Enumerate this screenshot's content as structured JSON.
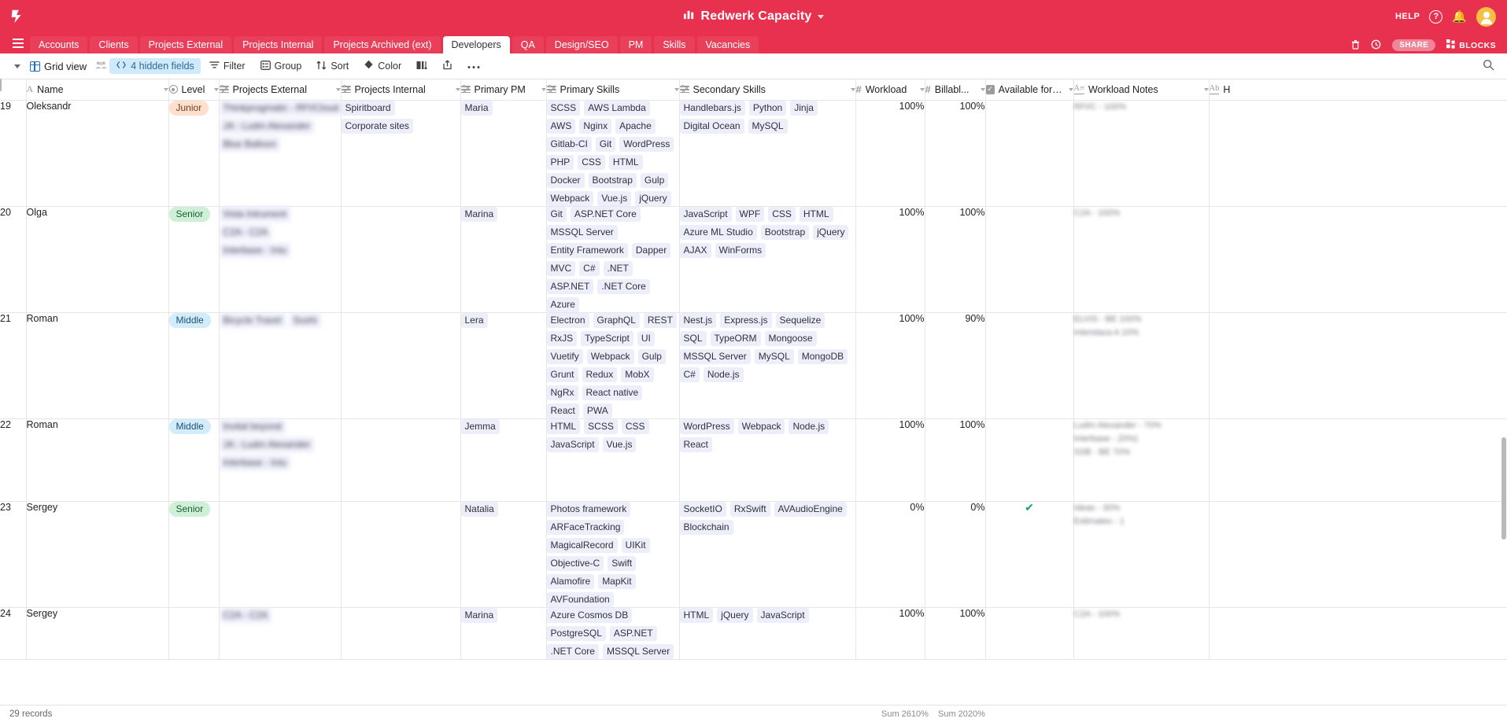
{
  "header": {
    "logo_icon": "redwerk-logo-icon",
    "app_title": "Redwerk Capacity",
    "title_icon": "bar-chart-icon",
    "title_caret_icon": "caret-down-icon",
    "help_label": "HELP",
    "help_icon": "question-circle-icon",
    "bell_icon": "bell-icon",
    "avatar_icon": "user-avatar",
    "brand_color": "#e8314f"
  },
  "tabs": {
    "menu_icon": "hamburger-menu-icon",
    "items": [
      {
        "label": "Accounts",
        "active": false
      },
      {
        "label": "Clients",
        "active": false
      },
      {
        "label": "Projects External",
        "active": false
      },
      {
        "label": "Projects Internal",
        "active": false
      },
      {
        "label": "Projects Archived (ext)",
        "active": false
      },
      {
        "label": "Developers",
        "active": true
      },
      {
        "label": "QA",
        "active": false
      },
      {
        "label": "Design/SEO",
        "active": false
      },
      {
        "label": "PM",
        "active": false
      },
      {
        "label": "Skills",
        "active": false
      },
      {
        "label": "Vacancies",
        "active": false
      }
    ],
    "right_actions": [
      {
        "label": "",
        "icon": "trash-icon"
      },
      {
        "label": "",
        "icon": "history-clock-icon"
      },
      {
        "label": "SHARE",
        "icon": "share-pill"
      },
      {
        "label": "BLOCKS",
        "icon": "blocks-icon"
      }
    ]
  },
  "toolbar": {
    "view_caret_icon": "caret-down-icon",
    "view_icon": "grid-view-icon",
    "view_name": "Grid view",
    "collaborators_icon": "collaborators-icon",
    "hidden_fields_label": "4 hidden fields",
    "hidden_fields_icon": "hidden-fields-icon",
    "filter_label": "Filter",
    "filter_icon": "filter-icon",
    "group_label": "Group",
    "group_icon": "group-icon",
    "sort_label": "Sort",
    "sort_icon": "sort-icon",
    "color_label": "Color",
    "color_icon": "color-palette-icon",
    "row_height_icon": "row-height-icon",
    "share_view_icon": "share-view-icon",
    "more_icon": "more-horizontal-icon",
    "search_icon": "search-icon"
  },
  "grid": {
    "columns": [
      {
        "label": "Name",
        "icon": "text-field-icon"
      },
      {
        "label": "Level",
        "icon": "single-select-icon"
      },
      {
        "label": "Projects External",
        "icon": "multi-select-icon"
      },
      {
        "label": "Projects Internal",
        "icon": "multi-select-icon"
      },
      {
        "label": "Primary PM",
        "icon": "multi-select-icon"
      },
      {
        "label": "Primary Skills",
        "icon": "multi-select-icon"
      },
      {
        "label": "Secondary Skills",
        "icon": "multi-select-icon"
      },
      {
        "label": "Workload",
        "icon": "number-field-icon"
      },
      {
        "label": "Billabl...",
        "icon": "number-field-icon"
      },
      {
        "label": "Available for E...",
        "icon": "checkbox-field-icon"
      },
      {
        "label": "Workload Notes",
        "icon": "long-text-icon"
      },
      {
        "label": "H",
        "icon": "text-field-icon"
      }
    ],
    "rows": [
      {
        "num": "19",
        "name": "Oleksandr",
        "level": "Junior",
        "level_class": "junior",
        "projects_external_redacted": [
          "Thinkprogmatic - RFI/Cloud",
          "JA - Ludm Alexander",
          "Blue Balloon"
        ],
        "projects_internal": [
          "Spiritboard",
          "Corporate sites"
        ],
        "primary_pm": [
          "Maria"
        ],
        "primary_skills": [
          "SCSS",
          "AWS Lambda",
          "AWS",
          "Nginx",
          "Apache",
          "Gitlab-CI",
          "Git",
          "WordPress",
          "PHP",
          "CSS",
          "HTML",
          "Docker",
          "Bootstrap",
          "Gulp",
          "Webpack",
          "Vue.js",
          "jQuery"
        ],
        "secondary_skills": [
          "Handlebars.js",
          "Python",
          "Jinja",
          "Digital Ocean",
          "MySQL"
        ],
        "workload": "100%",
        "billable": "100%",
        "available": false,
        "notes_redacted": [
          "RFI/C - 100%"
        ]
      },
      {
        "num": "20",
        "name": "Olga",
        "level": "Senior",
        "level_class": "senior",
        "projects_external_redacted": [
          "Vista Intrument",
          "C2A - C2A",
          "Interbase - Intu"
        ],
        "projects_internal": [],
        "primary_pm": [
          "Marina"
        ],
        "primary_skills": [
          "Git",
          "ASP.NET Core",
          "MSSQL Server",
          "Entity Framework",
          "Dapper",
          "MVC",
          "C#",
          ".NET",
          "ASP.NET",
          ".NET Core",
          "Azure"
        ],
        "secondary_skills": [
          "JavaScript",
          "WPF",
          "CSS",
          "HTML",
          "Azure ML Studio",
          "Bootstrap",
          "jQuery",
          "AJAX",
          "WinForms"
        ],
        "workload": "100%",
        "billable": "100%",
        "available": false,
        "notes_redacted": [
          "C2A - 100%"
        ]
      },
      {
        "num": "21",
        "name": "Roman",
        "level": "Middle",
        "level_class": "middle",
        "projects_external_redacted": [
          "Bicycle Travel",
          "Sushi"
        ],
        "projects_internal": [],
        "primary_pm": [
          "Lera"
        ],
        "primary_skills": [
          "Electron",
          "GraphQL",
          "REST",
          "RxJS",
          "TypeScript",
          "UI",
          "Vuetify",
          "Webpack",
          "Gulp",
          "Grunt",
          "Redux",
          "MobX",
          "NgRx",
          "React native",
          "React",
          "PWA"
        ],
        "secondary_skills": [
          "Nest.js",
          "Express.js",
          "Sequelize",
          "SQL",
          "TypeORM",
          "Mongoose",
          "MSSQL Server",
          "MySQL",
          "MongoDB",
          "C#",
          "Node.js"
        ],
        "workload": "100%",
        "billable": "90%",
        "available": false,
        "notes_redacted": [
          "ELVIS - BE 100%",
          "Interstaca A 10%"
        ]
      },
      {
        "num": "22",
        "name": "Roman",
        "level": "Middle",
        "level_class": "middle",
        "projects_external_redacted": [
          "Invital beyond",
          "JA - Ludm Alexander",
          "Interbase - Intu"
        ],
        "projects_internal": [],
        "primary_pm": [
          "Jemma"
        ],
        "primary_skills": [
          "HTML",
          "SCSS",
          "CSS",
          "JavaScript",
          "Vue.js"
        ],
        "secondary_skills": [
          "WordPress",
          "Webpack",
          "Node.js",
          "React"
        ],
        "workload": "100%",
        "billable": "100%",
        "available": false,
        "notes_redacted": [
          "Ludm Alexander - 70%",
          "Interbase - 20%)",
          "SSB - BE 70%"
        ]
      },
      {
        "num": "23",
        "name": "Sergey",
        "level": "Senior",
        "level_class": "senior",
        "projects_external_redacted": [],
        "projects_internal": [],
        "primary_pm": [
          "Natalia"
        ],
        "primary_skills": [
          "Photos framework",
          "ARFaceTracking",
          "MagicalRecord",
          "UIKit",
          "Objective-C",
          "Swift",
          "Alamofire",
          "MapKit",
          "AVFoundation"
        ],
        "secondary_skills": [
          "SocketIO",
          "RxSwift",
          "AVAudioEngine",
          "Blockchain"
        ],
        "workload": "0%",
        "billable": "0%",
        "available": true,
        "notes_redacted": [
          "Ideas - 30%",
          "Estimates - 1"
        ]
      },
      {
        "num": "24",
        "name": "Sergey",
        "level": "",
        "level_class": "",
        "projects_external_redacted": [
          "C2A - C2A"
        ],
        "projects_internal": [],
        "primary_pm": [
          "Marina"
        ],
        "primary_skills": [
          "Azure Cosmos DB",
          "PostgreSQL",
          "ASP.NET",
          ".NET Core",
          "MSSQL Server"
        ],
        "secondary_skills": [
          "HTML",
          "jQuery",
          "JavaScript"
        ],
        "workload": "100%",
        "billable": "100%",
        "available": false,
        "notes_redacted": [
          "C2A - 100%"
        ]
      }
    ],
    "summary": {
      "workload": "Sum 2610%",
      "billable": "Sum 2020%"
    }
  },
  "footer": {
    "record_count": "29 records"
  }
}
